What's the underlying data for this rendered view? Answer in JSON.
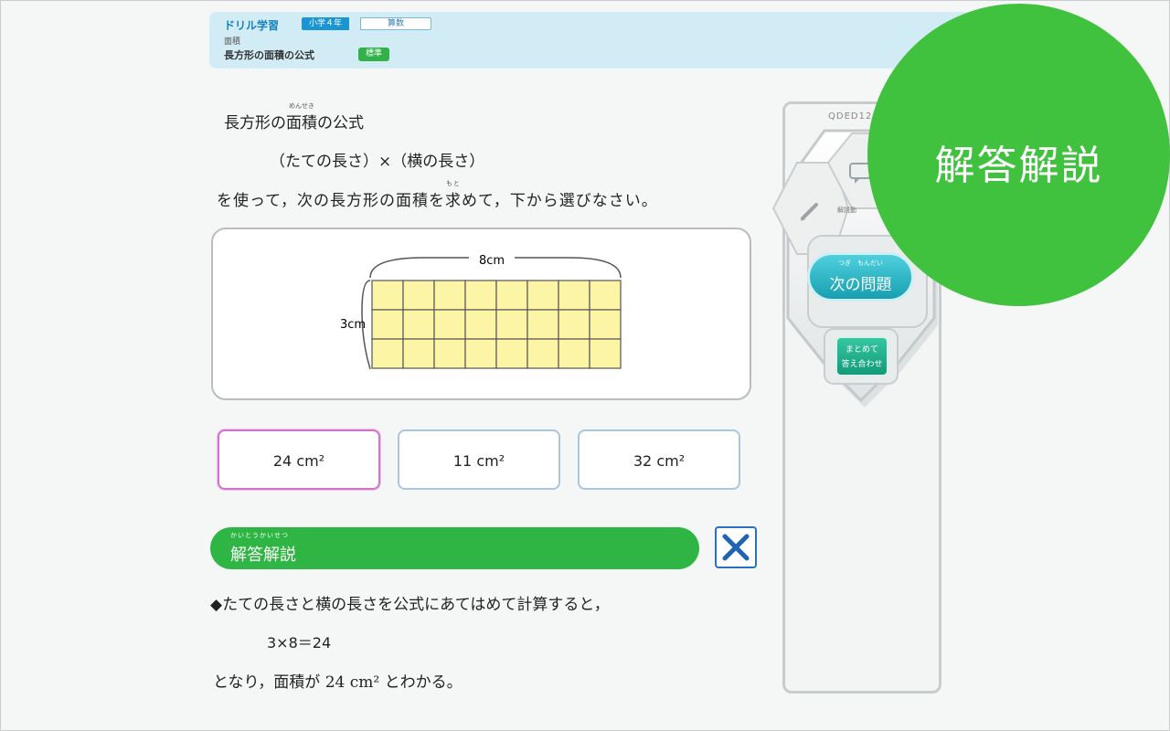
{
  "header": {
    "app_title": "ドリル学習",
    "grade": "小学４年",
    "subject": "算数",
    "unit": "面積",
    "topic": "長方形の面積の公式",
    "level": "標準"
  },
  "question": {
    "line1_a": "長方形の",
    "line1_ruby": "めんせき",
    "line1_b": "面積",
    "line1_c": "の公式",
    "formula": "（たての長さ）×（横の長さ）",
    "line3_a": "を使って，次の長方形の面積を",
    "line3_ruby": "もと",
    "line3_b": "求",
    "line3_c": "めて，下から選びなさい。"
  },
  "figure": {
    "width_label": "8cm",
    "height_label": "3cm",
    "cols": 8,
    "rows": 3,
    "fill": "#fdf5a6",
    "stroke": "#555555"
  },
  "choices": [
    {
      "label": "24 cm²",
      "selected": true
    },
    {
      "label": "11 cm²",
      "selected": false
    },
    {
      "label": "32 cm²",
      "selected": false
    }
  ],
  "explanation": {
    "ruby": "かいとうかいせつ",
    "title": "解答解説",
    "line1": "◆たての長さと横の長さを公式にあてはめて計算すると，",
    "line2": "3×8＝24",
    "line3": "となり，面積が 24 cm² とわかる。"
  },
  "side_panel": {
    "code": "QDED12",
    "chat_caption": "解説動",
    "next_ruby": "つぎ　もんだい",
    "next_label": "次の問題",
    "batch_line1": "まとめて",
    "batch_line2": "答え合わせ"
  },
  "overlay": {
    "bubble_text": "解答解説",
    "bubble_color": "#40c23e"
  },
  "colors": {
    "header_bg": "#d2ecf5",
    "green": "#2eb543",
    "teal": "#179fb2",
    "selected_border": "#d173c9",
    "close_blue": "#2a6fc2"
  }
}
